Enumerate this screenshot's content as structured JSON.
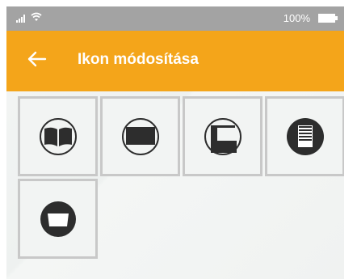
{
  "status_bar": {
    "battery_text": "100%",
    "icons": [
      "signal-icon",
      "wifi-icon",
      "battery-icon"
    ]
  },
  "app_bar": {
    "title": "Ikon módosítása",
    "back_icon": "back-arrow-icon"
  },
  "icons": [
    {
      "name": "book-icon"
    },
    {
      "name": "screen-icon"
    },
    {
      "name": "door-icon"
    },
    {
      "name": "shutter-icon"
    },
    {
      "name": "window-icon"
    }
  ],
  "colors": {
    "accent": "#f4a51a",
    "status_bar": "#a3a3a3",
    "tile_border": "#c8c8c8",
    "icon": "#2d2d2d"
  }
}
